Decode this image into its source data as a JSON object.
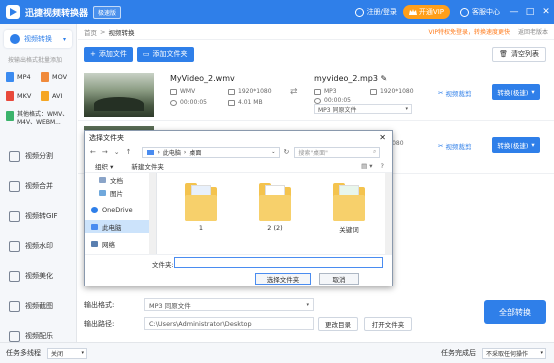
{
  "titlebar": {
    "app_title": "迅捷视频转换器",
    "version_badge": "极速版",
    "user_label": "注册/登录",
    "vip_label": "开通VIP",
    "service_label": "客服中心",
    "min_glyph": "—",
    "max_glyph": "□",
    "close_glyph": "✕"
  },
  "sidebar": {
    "active_label": "视频转换",
    "hint": "按输出格式批量添加",
    "formats": [
      "MP4",
      "MOV",
      "MKV",
      "AVI"
    ],
    "format_colors": [
      "#3b8bf0",
      "#f08a3b",
      "#e8493b",
      "#f5a623"
    ],
    "other_formats_line1": "其他格式：WMV、",
    "other_formats_line2": "M4V、WEBM...",
    "menu": [
      "视频分割",
      "视频合并",
      "视频转GIF",
      "视频水印",
      "视频美化",
      "视频截图",
      "视频配乐"
    ]
  },
  "breadcrumb": {
    "home": "首页",
    "sep": ">",
    "current": "视频转换",
    "vip_notice": "VIP特权免登录，转换速度更快",
    "old_version": "返回老版本"
  },
  "toolbar": {
    "add_file": "添加文件",
    "add_folder": "添加文件夹",
    "clear_list": "清空列表"
  },
  "rows": [
    {
      "src_name": "MyVideo_2.wmv",
      "src_format": "WMV",
      "src_resolution": "1920*1080",
      "src_duration": "00:00:05",
      "src_size": "4.01 MB",
      "dst_name": "myvideo_2.mp3",
      "dst_format": "MP3",
      "dst_resolution": "1920*1080",
      "dst_duration": "00:00:05",
      "dst_select": "MP3 同原文件",
      "edit_label": "视频裁剪",
      "convert_label": "转换(极速)"
    },
    {
      "dst_resolution": "1920*1080",
      "edit_label": "视频裁剪",
      "convert_label": "转换(极速)"
    }
  ],
  "bottom": {
    "output_format_label": "输出格式:",
    "output_format_value": "MP3  同原文件",
    "output_path_label": "输出路径:",
    "output_path_value": "C:\\Users\\Administrator\\Desktop",
    "change_dir": "更改目录",
    "open_folder": "打开文件夹",
    "convert_all": "全部转换"
  },
  "statusbar": {
    "multithread_label": "任务多线程",
    "multithread_value": "关闭",
    "done_label": "任务完成后",
    "done_value": "不采取任何操作"
  },
  "dialog": {
    "title": "选择文件夹",
    "path_part1": "此电脑",
    "path_part2": "桌面",
    "search_placeholder": "搜索\"桌面\"",
    "organize": "组织 ▾",
    "new_folder": "新建文件夹",
    "tree": [
      "文档",
      "图片",
      "OneDrive",
      "此电脑",
      "网络"
    ],
    "files": [
      "1",
      "2 (2)",
      "关键词"
    ],
    "filename_label": "文件夹:",
    "select_btn": "选择文件夹",
    "cancel_btn": "取消"
  }
}
